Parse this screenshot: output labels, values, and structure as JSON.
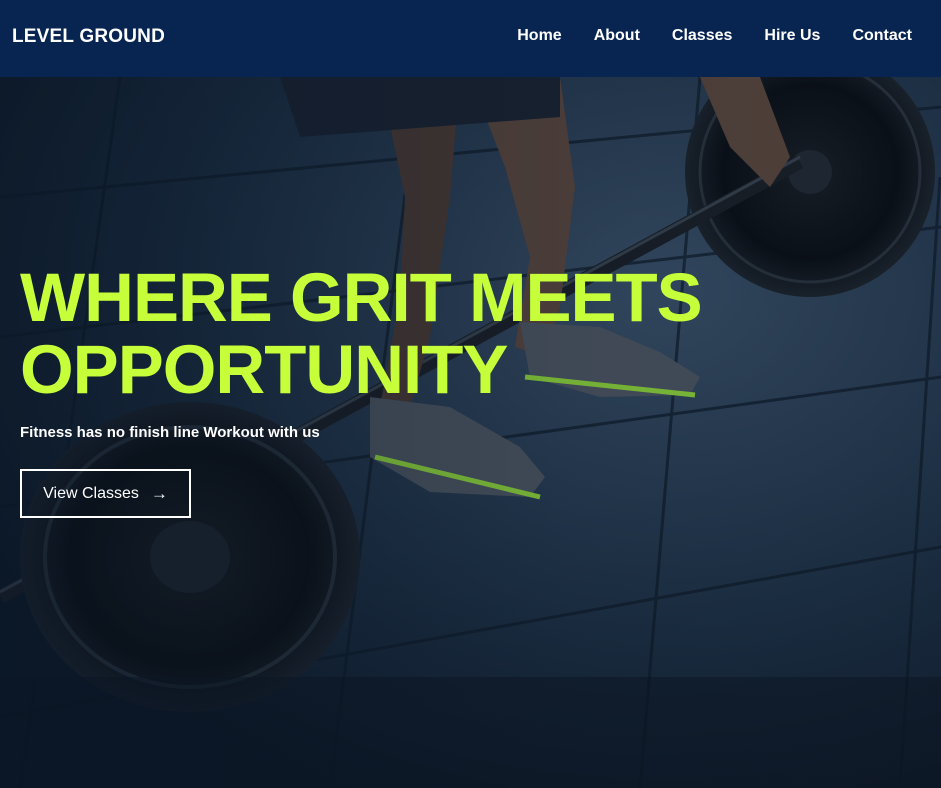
{
  "header": {
    "logo": "LEVEL GROUND",
    "nav": [
      {
        "label": "Home"
      },
      {
        "label": "About"
      },
      {
        "label": "Classes"
      },
      {
        "label": "Hire Us"
      },
      {
        "label": "Contact"
      }
    ]
  },
  "hero": {
    "title_line1": "WHERE GRIT MEETS",
    "title_line2": "OPPORTUNITY",
    "subtitle": "Fitness has no finish line Workout with us",
    "button_label": "View Classes",
    "button_icon": "arrow-right-icon",
    "background_image": "weightlifter-barbell-photo"
  },
  "colors": {
    "navbar": "#082552",
    "accent": "#c6ff3a",
    "text": "#ffffff"
  }
}
